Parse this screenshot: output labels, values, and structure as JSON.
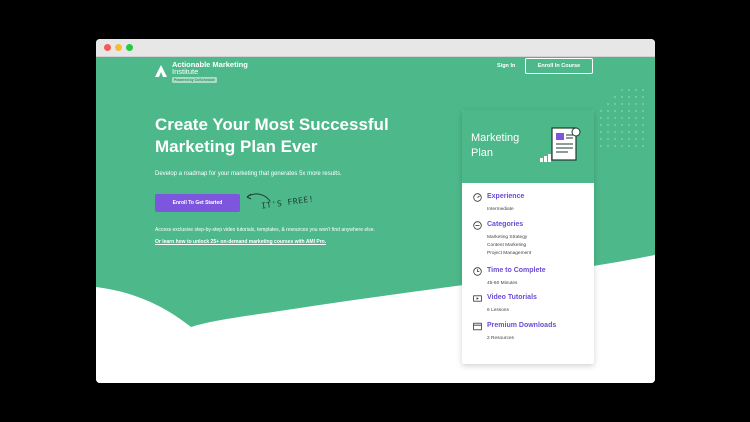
{
  "brand": {
    "name_line1": "Actionable Marketing",
    "name_line2": "Institute",
    "badge": "Powered by CoSchedule"
  },
  "nav": {
    "sign_in": "Sign In",
    "enroll": "Enroll In Course"
  },
  "hero": {
    "headline_line1": "Create Your Most Successful",
    "headline_line2": "Marketing Plan Ever",
    "subhead": "Develop a roadmap for your marketing that generates 5x more results.",
    "cta": "Enroll To Get Started",
    "free_note": "IT'S FREE!",
    "access_text": "Access exclusive step-by-step video tutorials, templates, & resources you won't find anywhere else.",
    "learn_link": "Or learn how to unlock 25+ on-demand marketing courses with AMI Pro."
  },
  "card": {
    "title_line1": "Marketing",
    "title_line2": "Plan",
    "items": [
      {
        "icon": "gauge-icon",
        "title": "Experience",
        "lines": [
          "Intermediate"
        ]
      },
      {
        "icon": "categories-icon",
        "title": "Categories",
        "lines": [
          "Marketing Strategy",
          "Content Marketing",
          "Project Management"
        ]
      },
      {
        "icon": "clock-icon",
        "title": "Time to Complete",
        "lines": [
          "45-60 Minutes"
        ]
      },
      {
        "icon": "video-icon",
        "title": "Video Tutorials",
        "lines": [
          "6 Lessons"
        ]
      },
      {
        "icon": "download-icon",
        "title": "Premium Downloads",
        "lines": [
          "2 Resources"
        ]
      }
    ]
  },
  "colors": {
    "brand_green": "#4db88a",
    "accent_purple": "#7c56dc",
    "text_purple": "#6b4bd6"
  }
}
